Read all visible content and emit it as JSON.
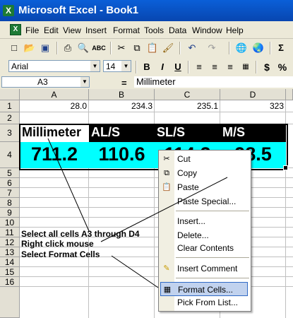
{
  "window": {
    "title": "Microsoft Excel - Book1",
    "app_icon": "X"
  },
  "menu": {
    "items": [
      "File",
      "Edit",
      "View",
      "Insert",
      "Format",
      "Tools",
      "Data",
      "Window",
      "Help"
    ]
  },
  "toolbar": {
    "icons": [
      "new-icon",
      "open-icon",
      "save-icon",
      "print-icon",
      "print-preview-icon",
      "spelling-icon",
      "cut-icon",
      "copy-icon",
      "paste-icon",
      "format-painter-icon",
      "undo-icon",
      "redo-icon",
      "hyperlink-icon",
      "web-icon",
      "autosum-icon"
    ],
    "font_name": "Arial",
    "font_size": "14",
    "bold": "B",
    "italic": "I",
    "underline": "U",
    "currency": "$",
    "percent": "%"
  },
  "formula_bar": {
    "name_box": "A3",
    "equals": "=",
    "content": "Millimeter"
  },
  "grid": {
    "columns": [
      "A",
      "B",
      "C",
      "D"
    ],
    "rows": [
      "1",
      "2",
      "3",
      "4",
      "5",
      "6",
      "7",
      "8",
      "9",
      "10",
      "11",
      "12",
      "13",
      "14",
      "15",
      "16"
    ],
    "row1": [
      "28.0",
      "234.3",
      "235.1",
      "323"
    ],
    "row3": [
      "Millimeter",
      "AL/S",
      "SL/S",
      "M/S"
    ],
    "row4": [
      "711.2",
      "110.6",
      "114.2",
      "98.5"
    ],
    "colors": {
      "header_bg": "#000000",
      "header_text": "#ffffff",
      "value_bg": "#00ffff"
    }
  },
  "annotations": {
    "line1": "Select all cells A3 through D4",
    "line2": "Right click mouse",
    "line3": "Select Format Cells"
  },
  "context_menu": {
    "items": [
      {
        "label": "Cut",
        "icon": "scissors-icon"
      },
      {
        "label": "Copy",
        "icon": "copy-icon"
      },
      {
        "label": "Paste",
        "icon": "paste-icon"
      },
      {
        "label": "Paste Special..."
      },
      {
        "label": "Insert..."
      },
      {
        "label": "Delete..."
      },
      {
        "label": "Clear Contents"
      },
      {
        "label": "Insert Comment",
        "icon": "comment-icon"
      },
      {
        "label": "Format Cells...",
        "icon": "format-cells-icon",
        "highlighted": true
      },
      {
        "label": "Pick From List..."
      }
    ]
  }
}
